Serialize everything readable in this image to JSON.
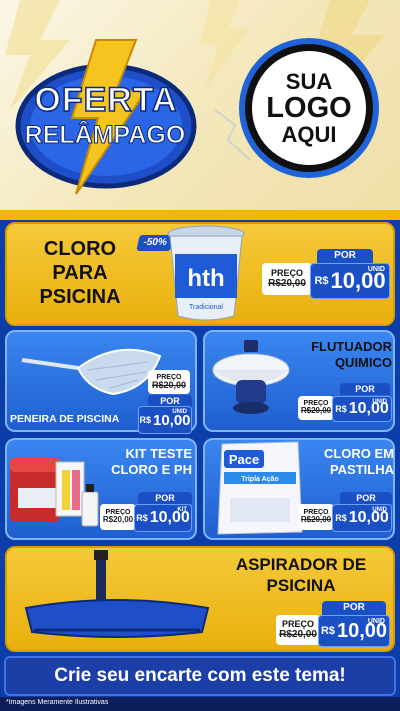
{
  "header": {
    "badge_line1": "OFERTA",
    "badge_line2": "RELÂMPAGO",
    "logo_line1": "SUA",
    "logo_line2": "LOGO",
    "logo_line3": "AQUI"
  },
  "products": [
    {
      "title_l1": "CLORO",
      "title_l2": "PARA",
      "title_l3": "PSICINA",
      "discount": "-50%",
      "preco_label": "PREÇO",
      "old_price": "R$20,00",
      "por_label": "POR",
      "currency": "R$",
      "price": "10,00",
      "unit": "UNID"
    },
    {
      "title": "PENEIRA DE PISCINA",
      "preco_label": "PREÇO",
      "old_price": "R$20,00",
      "por_label": "POR",
      "currency": "R$",
      "price": "10,00",
      "unit": "UNID"
    },
    {
      "title_l1": "FLUTUADOR",
      "title_l2": "QUIMICO",
      "preco_label": "PREÇO",
      "old_price": "R$20,00",
      "por_label": "POR",
      "currency": "R$",
      "price": "10,00",
      "unit": "UNID"
    },
    {
      "title_l1": "KIT TESTE",
      "title_l2": "CLORO E PH",
      "preco_label": "PREÇO",
      "old_price": "R$20,00",
      "por_label": "POR",
      "currency": "R$",
      "price": "10,00",
      "unit": "KIT"
    },
    {
      "title_l1": "CLORO EM",
      "title_l2": "PASTILHA",
      "preco_label": "PREÇO",
      "old_price": "R$20,00",
      "por_label": "POR",
      "currency": "R$",
      "price": "10,00",
      "unit": "UNID"
    },
    {
      "title_l1": "ASPIRADOR DE",
      "title_l2": "PSICINA",
      "preco_label": "PREÇO",
      "old_price": "R$20,00",
      "por_label": "POR",
      "currency": "R$",
      "price": "10,00",
      "unit": "UNID"
    }
  ],
  "product_images": {
    "bucket_brand": "hth",
    "bucket_sublabel": "Tradicional",
    "pace_brand": "Pace",
    "pace_sub": "Tripla Ação"
  },
  "cta": "Crie seu encarte com este tema!",
  "disclaimer": "*Imagens Meramente Ilustrativas",
  "colors": {
    "blue": "#1b4fc4",
    "yellow": "#f5c93a",
    "dark_blue": "#0b3ea8"
  }
}
